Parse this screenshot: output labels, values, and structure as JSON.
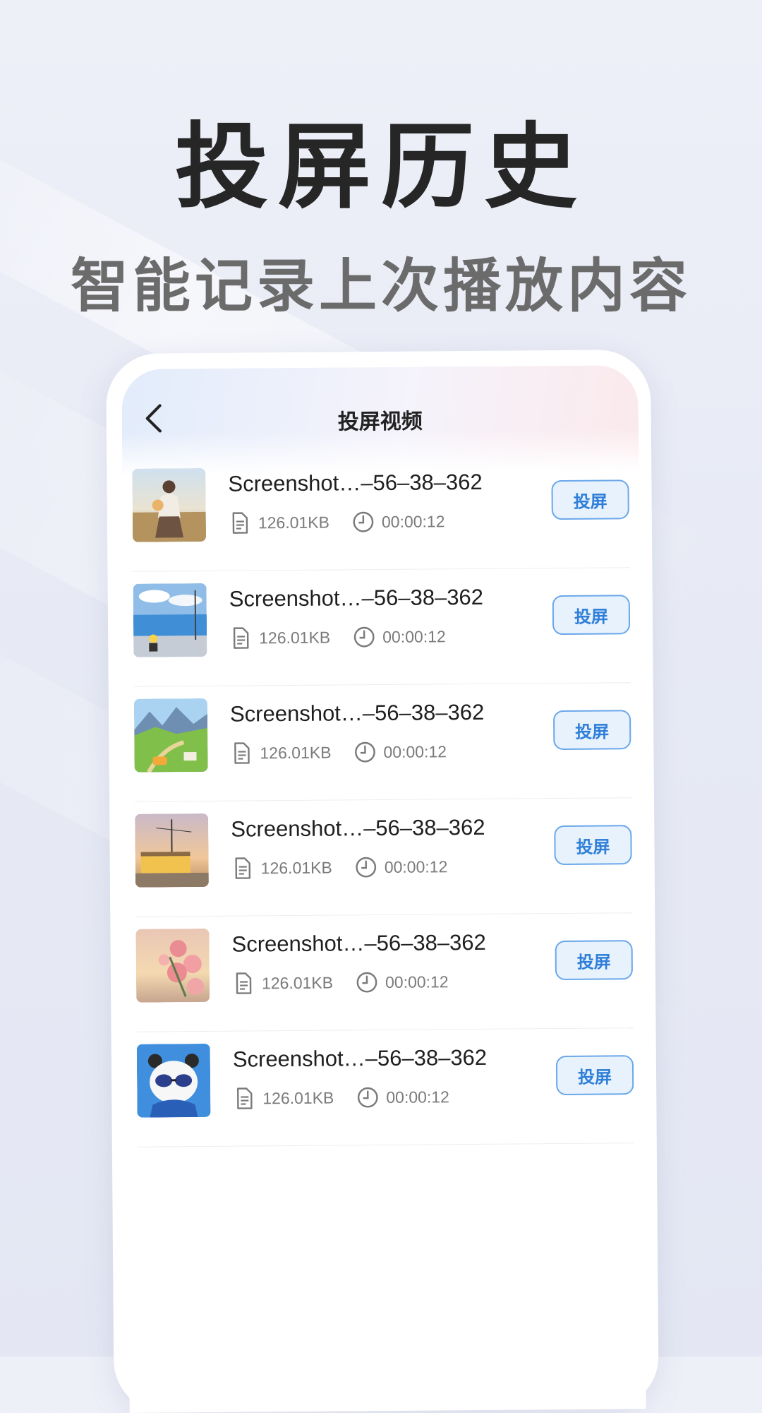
{
  "promo": {
    "headline": "投屏历史",
    "subheadline": "智能记录上次播放内容"
  },
  "screen": {
    "title": "投屏视频",
    "back_icon": "chevron-left-icon",
    "items": [
      {
        "title": "Screenshot…–56–38–362",
        "size": "126.01KB",
        "duration": "00:00:12",
        "action": "投屏",
        "thumb": "girl-with-puppy"
      },
      {
        "title": "Screenshot…–56–38–362",
        "size": "126.01KB",
        "duration": "00:00:12",
        "action": "投屏",
        "thumb": "seaside-road"
      },
      {
        "title": "Screenshot…–56–38–362",
        "size": "126.01KB",
        "duration": "00:00:12",
        "action": "投屏",
        "thumb": "mountain-meadow"
      },
      {
        "title": "Screenshot…–56–38–362",
        "size": "126.01KB",
        "duration": "00:00:12",
        "action": "投屏",
        "thumb": "evening-street"
      },
      {
        "title": "Screenshot…–56–38–362",
        "size": "126.01KB",
        "duration": "00:00:12",
        "action": "投屏",
        "thumb": "pink-roses"
      },
      {
        "title": "Screenshot…–56–38–362",
        "size": "126.01KB",
        "duration": "00:00:12",
        "action": "投屏",
        "thumb": "panda-sunglasses"
      }
    ]
  },
  "colors": {
    "accent": "#2f7fd8",
    "button_bg": "#e8f2fd",
    "button_border": "#6aa7ea"
  }
}
